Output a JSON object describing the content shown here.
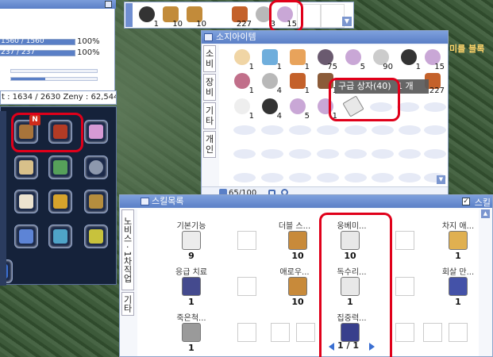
{
  "status": {
    "hp_text": "1560 / 1560",
    "hp_pct": "100%",
    "sp_text": "237 / 237",
    "sp_pct": "100%",
    "weight_text": "t : 1634 / 2630",
    "zeny_text": "Zeny : 62,544"
  },
  "hotbar": {
    "slots": [
      {
        "qty": "1"
      },
      {
        "qty": "10"
      },
      {
        "qty": "10"
      },
      {
        "qty": ""
      },
      {
        "qty": "227"
      },
      {
        "qty": "3"
      },
      {
        "qty": "15"
      }
    ]
  },
  "badge": {
    "text": "N"
  },
  "background_text": "미를 블록",
  "inventory": {
    "title": "소지아이템",
    "tabs": [
      "소비",
      "장비",
      "기타",
      "개인"
    ],
    "quantities_row1": [
      "1",
      "1",
      "1",
      "75",
      "5",
      "90",
      "1",
      "15"
    ],
    "quantities_row2": [
      "1",
      "4",
      "1",
      "1",
      "",
      "",
      "",
      "227"
    ],
    "quantities_row3": [
      "1",
      "4",
      "5",
      "1"
    ],
    "tooltip": "구급 상자(40)",
    "tooltip_tail": "1 개",
    "count": "65/100"
  },
  "skills": {
    "title": "스킬목록",
    "right_label": "스킬",
    "tab_label": "노비스 · 1차직업",
    "other_tab": "기타",
    "items": [
      {
        "name": "기본기능",
        "level": "9"
      },
      {
        "name": "더블 스...",
        "level": "10"
      },
      {
        "name": "웅베미...",
        "level": "10"
      },
      {
        "name": "차지 애...",
        "level": "1"
      },
      {
        "name": "응급 치료",
        "level": "1"
      },
      {
        "name": "애로우...",
        "level": "10"
      },
      {
        "name": "독수리...",
        "level": "1"
      },
      {
        "name": "회살 만...",
        "level": "1"
      },
      {
        "name": "죽은척...",
        "level": "1"
      },
      {
        "name": "집중력...",
        "level": ""
      }
    ],
    "page": "1 / 1"
  },
  "colors": {
    "accent": "#5a7fc6",
    "highlight": "#e0001a"
  }
}
